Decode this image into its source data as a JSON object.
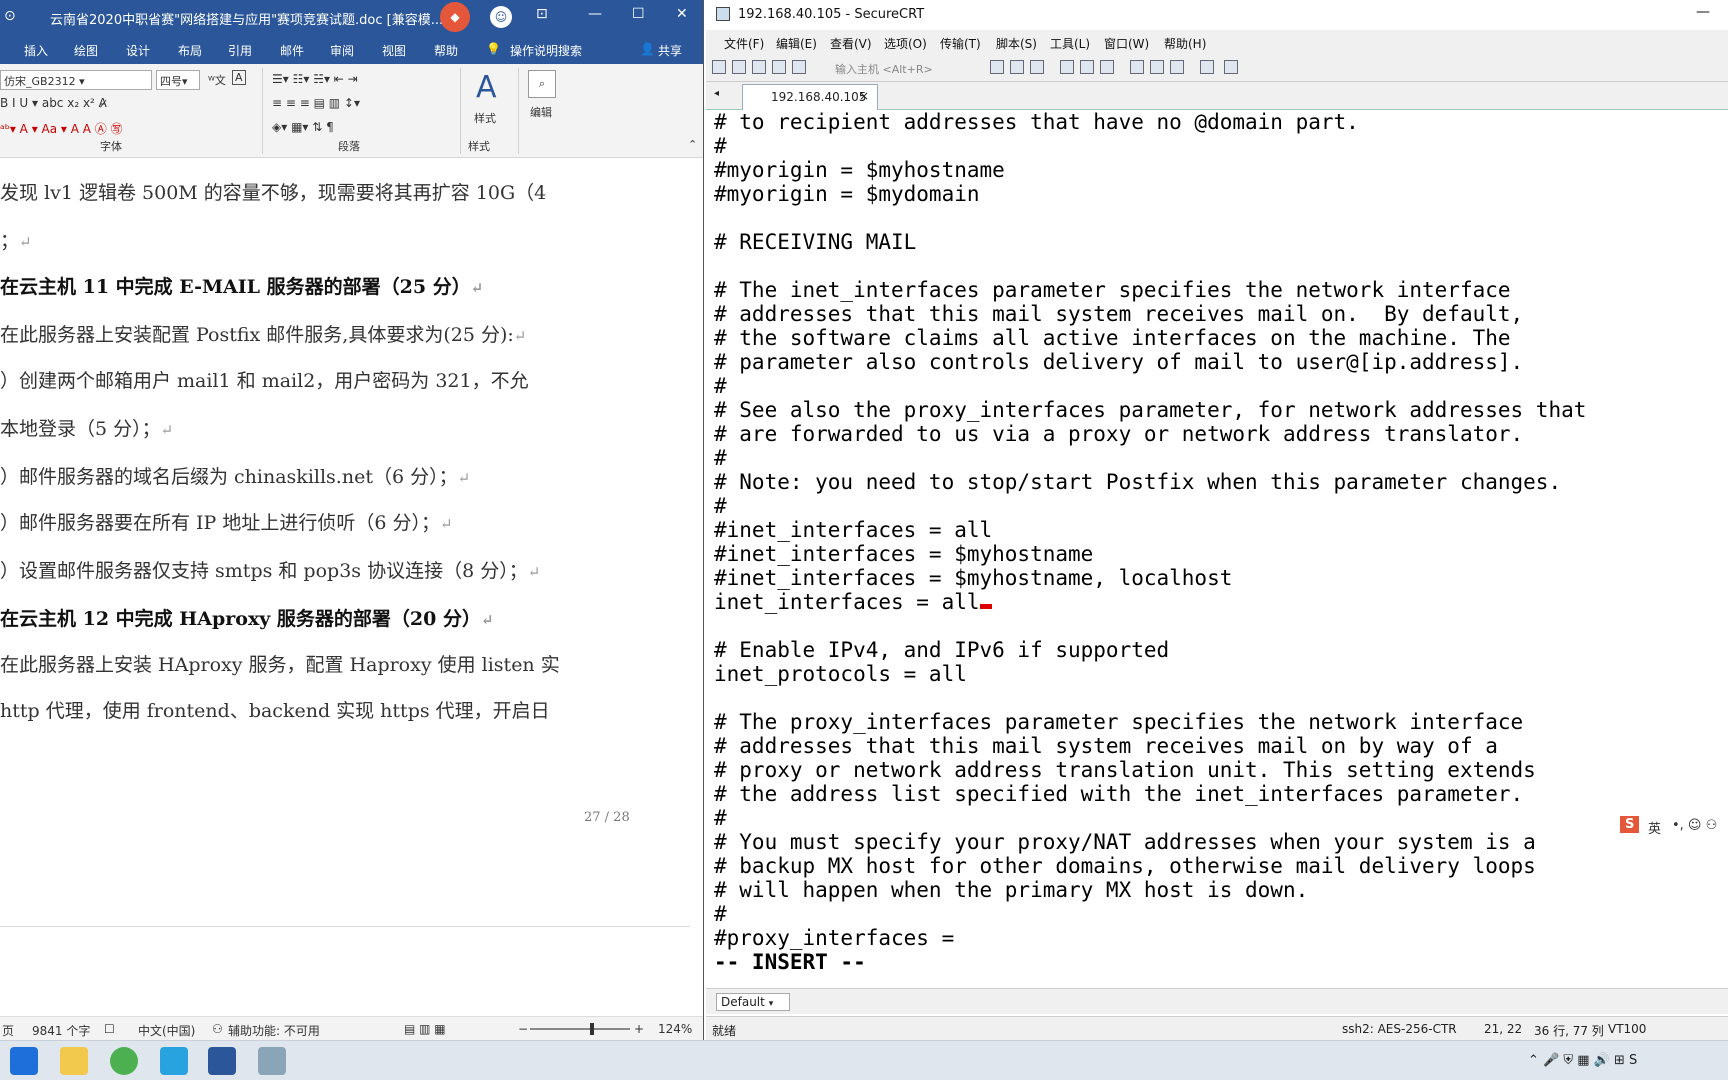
{
  "word": {
    "title": "云南省2020中职省赛\"网络搭建与应用\"赛项竞赛试题.doc [兼容模...",
    "tabs": [
      "插入",
      "绘图",
      "设计",
      "布局",
      "引用",
      "邮件",
      "审阅",
      "视图",
      "帮助"
    ],
    "search_label": "操作说明搜索",
    "share_label": "共享",
    "font_name": "仿宋_GB2312",
    "font_size": "四号",
    "group_font": "字体",
    "group_para": "段落",
    "group_style": "样式",
    "style_label": "样式",
    "edit_label": "编辑",
    "doc_lines": [
      {
        "text": "发现 lv1 逻辑卷 500M 的容量不够，现需要将其再扩容 10G（4",
        "bold": false,
        "ret": ""
      },
      {
        "text": "；",
        "bold": false,
        "ret": "↵"
      },
      {
        "text": "在云主机 11 中完成 E-MAIL 服务器的部署（25 分）",
        "bold": true,
        "ret": "↵"
      },
      {
        "text": "在此服务器上安装配置 Postfix 邮件服务,具体要求为(25 分):",
        "bold": false,
        "ret": "↵"
      },
      {
        "text": "）创建两个邮箱用户 mail1 和 mail2，用户密码为 321，不允",
        "bold": false,
        "ret": ""
      },
      {
        "text": "本地登录（5 分）；",
        "bold": false,
        "ret": "↵"
      },
      {
        "text": "）邮件服务器的域名后缀为 chinaskills.net（6 分）；",
        "bold": false,
        "ret": "↵"
      },
      {
        "text": "）邮件服务器要在所有 IP 地址上进行侦听（6 分）；",
        "bold": false,
        "ret": "↵"
      },
      {
        "text": "）设置邮件服务器仅支持 smtps 和 pop3s 协议连接（8 分）；",
        "bold": false,
        "ret": "↵"
      },
      {
        "text": "在云主机 12 中完成 HAproxy 服务器的部署（20 分）",
        "bold": true,
        "ret": "↵"
      },
      {
        "text": "在此服务器上安装 HAproxy 服务，配置 Haproxy 使用 listen 实",
        "bold": false,
        "ret": ""
      },
      {
        "text": "http 代理，使用 frontend、backend 实现 https 代理，开启日",
        "bold": false,
        "ret": ""
      }
    ],
    "page_number": "27 / 28",
    "status": {
      "page": "页",
      "words": "9841 个字",
      "lang": "中文(中国)",
      "accessibility": "辅助功能: 不可用",
      "zoom": "124%",
      "zoom_fraction": 0.62
    }
  },
  "crt": {
    "title": "192.168.40.105 - SecureCRT",
    "menu": [
      "文件(F)",
      "编辑(E)",
      "查看(V)",
      "选项(O)",
      "传输(T)",
      "脚本(S)",
      "工具(L)",
      "窗口(W)",
      "帮助(H)"
    ],
    "host_placeholder": "输入主机 <Alt+R>",
    "tab_label": "192.168.40.105",
    "tab_close": "×",
    "terminal_lines": [
      "# to recipient addresses that have no @domain part.",
      "#",
      "#myorigin = $myhostname",
      "#myorigin = $mydomain",
      "",
      "# RECEIVING MAIL",
      "",
      "# The inet_interfaces parameter specifies the network interface",
      "# addresses that this mail system receives mail on.  By default,",
      "# the software claims all active interfaces on the machine. The",
      "# parameter also controls delivery of mail to user@[ip.address].",
      "#",
      "# See also the proxy_interfaces parameter, for network addresses that",
      "# are forwarded to us via a proxy or network address translator.",
      "#",
      "# Note: you need to stop/start Postfix when this parameter changes.",
      "#",
      "#inet_interfaces = all",
      "#inet_interfaces = $myhostname",
      "#inet_interfaces = $myhostname, localhost",
      "inet_interfaces = all",
      "",
      "# Enable IPv4, and IPv6 if supported",
      "inet_protocols = all",
      "",
      "# The proxy_interfaces parameter specifies the network interface",
      "# addresses that this mail system receives mail on by way of a",
      "# proxy or network address translation unit. This setting extends",
      "# the address list specified with the inet_interfaces parameter.",
      "#",
      "# You must specify your proxy/NAT addresses when your system is a",
      "# backup MX host for other domains, otherwise mail delivery loops",
      "# will happen when the primary MX host is down.",
      "#",
      "#proxy_interfaces =",
      "-- INSERT --"
    ],
    "session_select": "Default",
    "status": {
      "ready": "就绪",
      "cipher": "ssh2: AES-256-CTR",
      "pos": "21, 22",
      "size": "36 行, 77 列",
      "term": "VT100"
    }
  },
  "ime": {
    "lang": "英"
  },
  "colors": {
    "word_blue": "#2b579a",
    "crt_bg": "#ffffff"
  }
}
